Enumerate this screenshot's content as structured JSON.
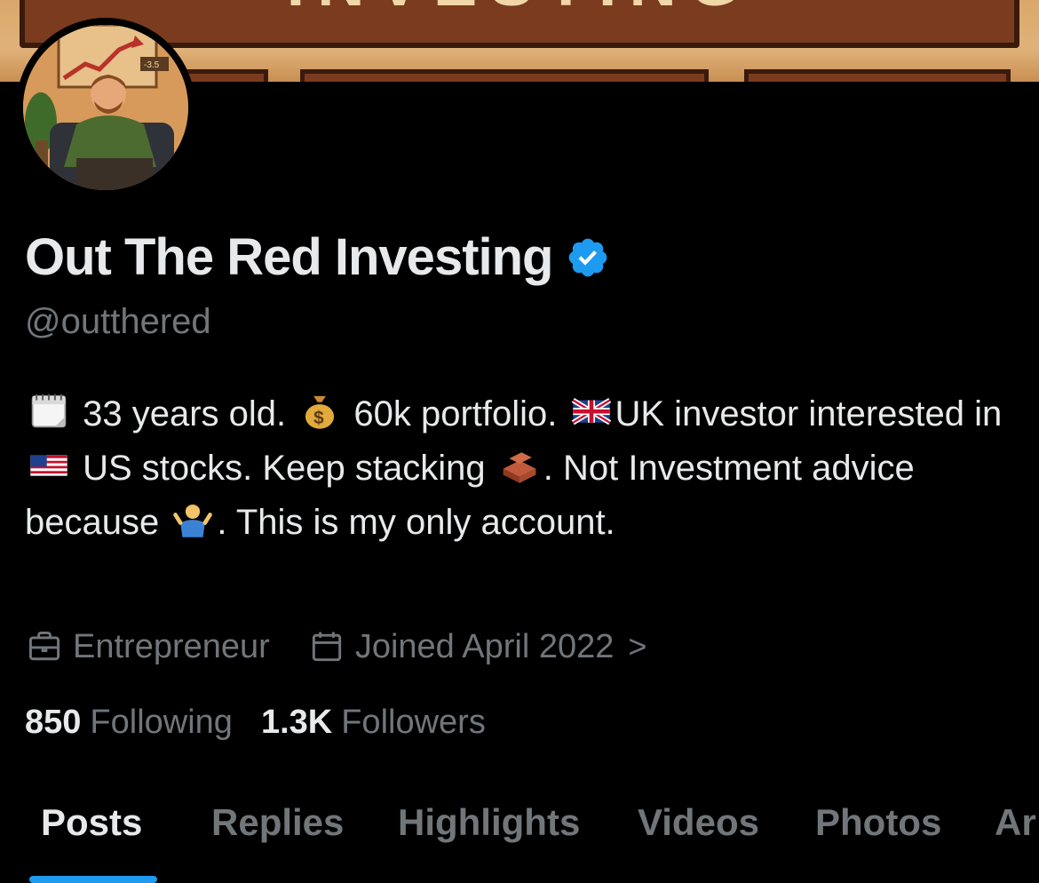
{
  "banner": {
    "word": "INVESTING",
    "badge": "-3.5"
  },
  "profile": {
    "display_name": "Out The Red Investing",
    "handle": "@outthered",
    "verified": true
  },
  "bio": {
    "segments": [
      {
        "emoji": "calendar",
        "text": " 33 years old. "
      },
      {
        "emoji": "money-bag",
        "text": " 60k portfolio. "
      },
      {
        "emoji": "uk-flag",
        "text": "UK investor interested in "
      },
      {
        "emoji": "us-flag",
        "text": " US stocks. Keep stacking "
      },
      {
        "emoji": "bricks",
        "text": ". Not Investment advice because "
      },
      {
        "emoji": "person-shrugging",
        "text": ". This is my only account."
      }
    ]
  },
  "meta": {
    "profession": "Entrepreneur",
    "joined": "Joined April 2022",
    "chevron": ">"
  },
  "stats": {
    "following_count": "850",
    "following_label": "Following",
    "followers_count": "1.3K",
    "followers_label": "Followers"
  },
  "tabs": [
    {
      "label": "Posts",
      "active": true
    },
    {
      "label": "Replies",
      "active": false
    },
    {
      "label": "Highlights",
      "active": false
    },
    {
      "label": "Videos",
      "active": false
    },
    {
      "label": "Photos",
      "active": false
    },
    {
      "label": "Ar",
      "active": false
    }
  ],
  "colors": {
    "background": "#000000",
    "text_primary": "#e7e9ea",
    "text_secondary": "#71767b",
    "accent": "#1d9bf0"
  }
}
